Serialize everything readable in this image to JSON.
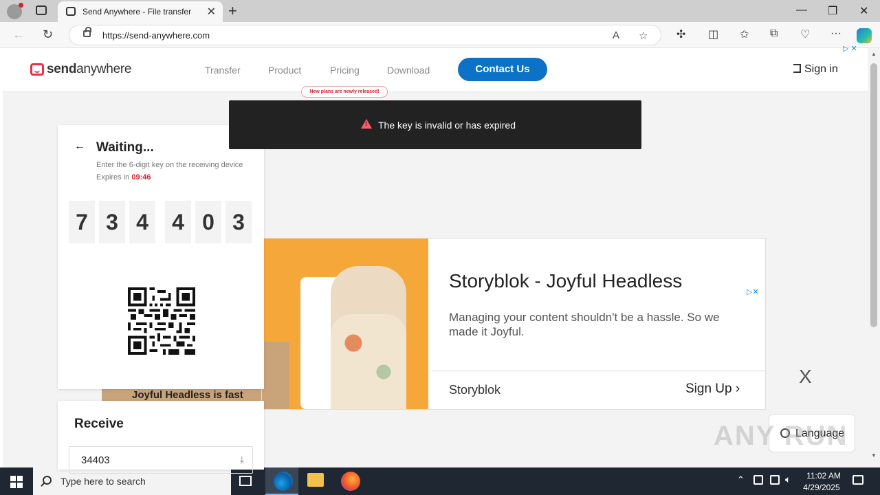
{
  "browser": {
    "tab_title": "Send Anywhere - File transfer",
    "tab_close": "✕",
    "new_tab": "+",
    "url": "https://send-anywhere.com",
    "window_controls": {
      "minimize": "—",
      "restore": "❐",
      "close": "✕"
    }
  },
  "site": {
    "logo": {
      "bold": "send",
      "regular": "anywhere"
    },
    "nav": [
      {
        "label": "Transfer"
      },
      {
        "label": "Product"
      },
      {
        "label": "Pricing"
      },
      {
        "label": "Download"
      }
    ],
    "promo_badge": "New plans are newly released!",
    "contact_button": "Contact Us",
    "sign_in": "Sign in"
  },
  "toast": {
    "message": "The key is invalid or has expired"
  },
  "waiting": {
    "title": "Waiting...",
    "subtitle": "Enter the 6-digit key on the receiving device",
    "expires_label": "Expires in ",
    "expires_time": "09:46",
    "digits": [
      "7",
      "3",
      "4",
      "4",
      "0",
      "3"
    ]
  },
  "receive": {
    "title": "Receive",
    "input_value": "34403"
  },
  "ad": {
    "headline": "Storyblok - Joyful Headless",
    "body": "Managing your content shouldn't be a hassle. So we made it Joyful.",
    "brand": "Storyblok",
    "cta": "Sign Up",
    "close_x": "X",
    "side_text": "Joyful Headless is fast"
  },
  "language": {
    "label": "Language"
  },
  "watermark": "ANY RUN",
  "taskbar": {
    "search_placeholder": "Type here to search",
    "time": "11:02 AM",
    "date": "4/29/2025"
  },
  "colors": {
    "brand_red": "#e8304a",
    "contact_blue": "#0b72c5",
    "toast_bg": "#222222",
    "expire_red": "#d3202d"
  }
}
